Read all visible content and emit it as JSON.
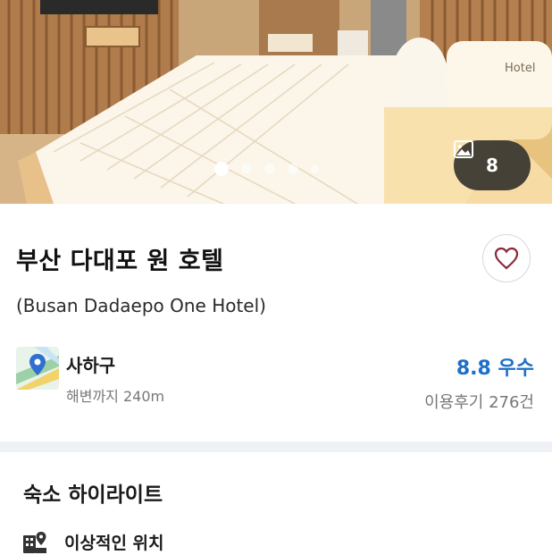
{
  "hero": {
    "image_description": "hotel-room-photo",
    "carousel_total_dots": 5,
    "carousel_active_index": 0,
    "photo_count": "8",
    "photo_icon": "image-icon"
  },
  "hotel": {
    "name": "부산 다대포 원 호텔",
    "english_name": "(Busan Dadaepo One Hotel)",
    "favorite_icon": "heart-icon"
  },
  "location": {
    "icon": "map-pin-icon",
    "district": "사하구",
    "distance": "해변까지 240m"
  },
  "review": {
    "rating": "8.8 우수",
    "count": "이용후기 276건"
  },
  "highlights": {
    "title": "숙소 하이라이트",
    "items": [
      {
        "icon": "building-location-icon",
        "label": "이상적인 위치"
      }
    ]
  },
  "colors": {
    "rating_blue": "#1d6fc7",
    "divider": "#eef1f6"
  }
}
